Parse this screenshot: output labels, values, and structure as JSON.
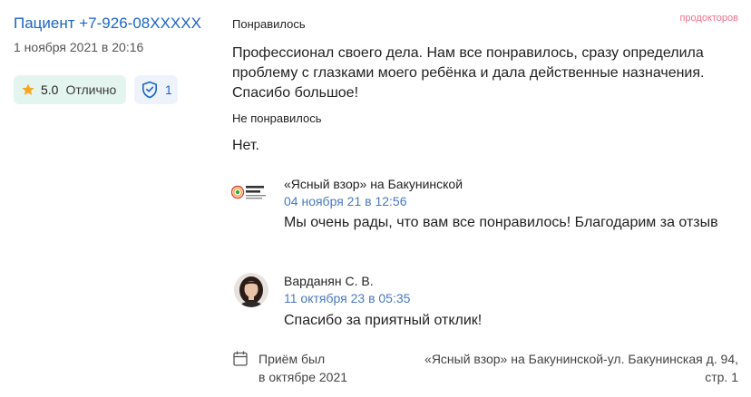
{
  "review": {
    "author": "Пациент +7-926-08XXXXX",
    "date": "1 ноября 2021 в 20:16",
    "rating_value": "5.0",
    "rating_word": "Отлично",
    "verified_count": "1",
    "brand": "продокторов",
    "liked_label": "Понравилось",
    "liked_text": "Профессионал своего дела. Нам все понравилось, сразу определила проблему с глазками моего ребёнка и дала действенные назначения. Спасибо большое!",
    "disliked_label": "Не понравилось",
    "disliked_text": "Нет."
  },
  "replies": [
    {
      "name": "«Ясный взор» на Бакунинской",
      "date": "04 ноября 21 в 12:56",
      "text": "Мы очень рады, что вам все понравилось! Благодарим за отзыв",
      "icon": "clinic-logo"
    },
    {
      "name": "Варданян С. В.",
      "date": "11 октября 23 в 05:35",
      "text": "Спасибо за приятный отклик!",
      "icon": "doctor-avatar"
    }
  ],
  "footer": {
    "visit_line1": "Приём был",
    "visit_line2": "в октябре 2021",
    "address": "«Ясный взор» на Бакунинской-ул. Бакунинская д. 94, стр. 1"
  },
  "colors": {
    "accent": "#1e64c8",
    "rating_bg": "#e4f5ef",
    "star": "#f5a623",
    "brand": "#f0718a"
  }
}
